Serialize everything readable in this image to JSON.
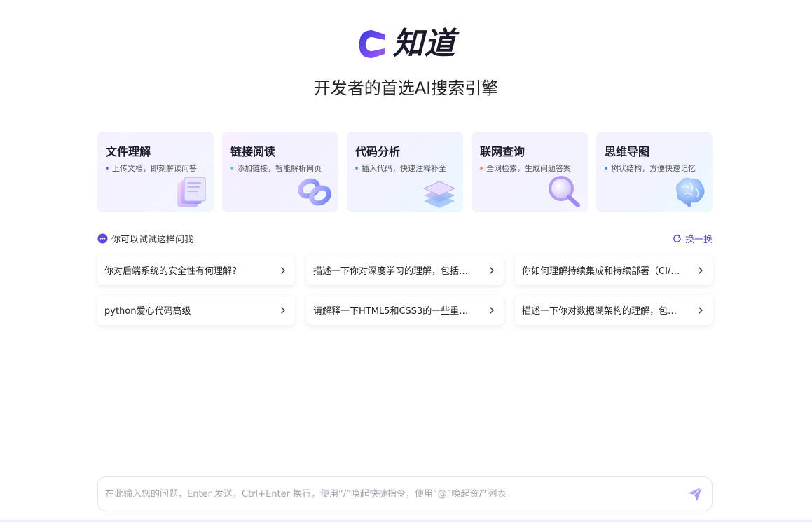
{
  "brand": {
    "name": "知道",
    "tagline": "开发者的首选AI搜索引擎",
    "accent": "#6a4cf5"
  },
  "features": [
    {
      "title": "文件理解",
      "desc": "上传文档，即刻解读问答",
      "dot_color": "#7b5cf0",
      "icon": "documents-stack-icon"
    },
    {
      "title": "链接阅读",
      "desc": "添加链接，智能解析网页",
      "dot_color": "#57d6c9",
      "icon": "chain-link-icon"
    },
    {
      "title": "代码分析",
      "desc": "插入代码，快速注释补全",
      "dot_color": "#4c8ef5",
      "icon": "code-layers-icon"
    },
    {
      "title": "联网查询",
      "desc": "全网检索，生成问题答案",
      "dot_color": "#f08a6a",
      "icon": "magnifier-icon"
    },
    {
      "title": "思维导图",
      "desc": "树状结构，方便快速记忆",
      "dot_color": "#4c8ef5",
      "icon": "brain-icon"
    }
  ],
  "suggestions": {
    "label": "你可以试试这样问我",
    "refresh_label": "换一换",
    "items": [
      "你对后端系统的安全性有何理解?",
      "描述一下你对深度学习的理解，包括…",
      "你如何理解持续集成和持续部署（CI/…",
      "python爱心代码高级",
      "请解释一下HTML5和CSS3的一些重…",
      "描述一下你对数据湖架构的理解，包…"
    ]
  },
  "input": {
    "placeholder": "在此输入您的问题，Enter 发送，Ctrl+Enter 换行，使用“/”唤起快捷指令，使用“@”唤起资产列表。"
  }
}
